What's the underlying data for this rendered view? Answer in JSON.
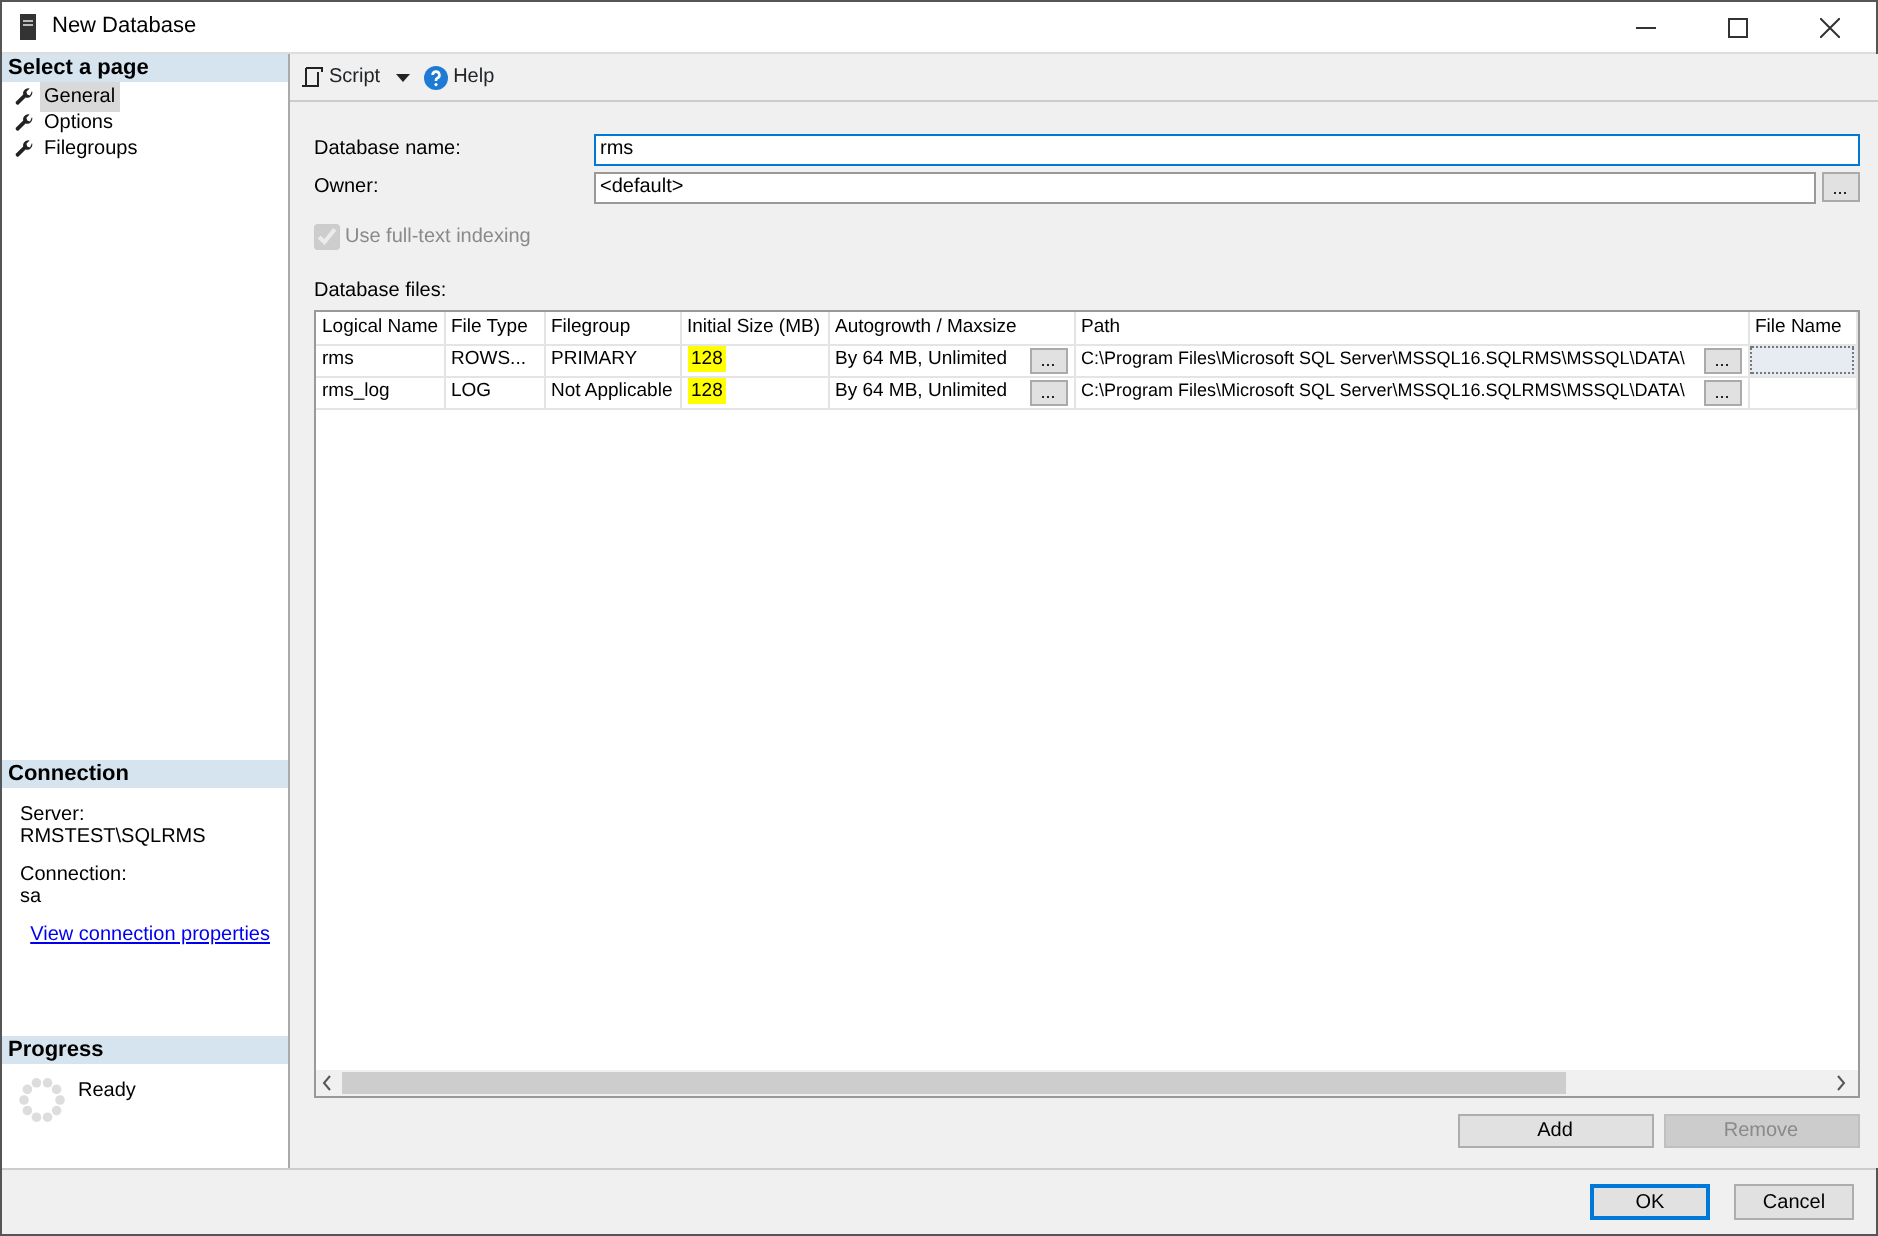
{
  "window": {
    "title": "New Database"
  },
  "sidebar": {
    "header": "Select a page",
    "items": [
      {
        "label": "General",
        "selected": true
      },
      {
        "label": "Options",
        "selected": false
      },
      {
        "label": "Filegroups",
        "selected": false
      }
    ]
  },
  "connection": {
    "header": "Connection",
    "server_label": "Server:",
    "server": "RMSTEST\\SQLRMS",
    "connection_label": "Connection:",
    "connection": "sa",
    "link": "View connection properties"
  },
  "progress": {
    "header": "Progress",
    "status": "Ready"
  },
  "toolbar": {
    "script": "Script",
    "help": "Help"
  },
  "form": {
    "database_name_label": "Database name:",
    "database_name": "rms",
    "owner_label": "Owner:",
    "owner": "<default>",
    "owner_browse": "...",
    "fulltext": {
      "label": "Use full-text indexing",
      "checked": true,
      "disabled": true
    }
  },
  "files": {
    "label": "Database files:",
    "columns": [
      "Logical Name",
      "File Type",
      "Filegroup",
      "Initial Size (MB)",
      "Autogrowth / Maxsize",
      "Path",
      "File Name"
    ],
    "rows": [
      {
        "logical_name": "rms",
        "file_type": "ROWS...",
        "filegroup": "PRIMARY",
        "initial_size": "128",
        "size_highlighted": true,
        "autogrowth": "By 64 MB, Unlimited",
        "autogrowth_button": "...",
        "path": "C:\\Program Files\\Microsoft SQL Server\\MSSQL16.SQLRMS\\MSSQL\\DATA\\",
        "path_button": "...",
        "file_name_focused": true
      },
      {
        "logical_name": "rms_log",
        "file_type": "LOG",
        "filegroup": "Not Applicable",
        "initial_size": "128",
        "size_highlighted": true,
        "autogrowth": "By 64 MB, Unlimited",
        "autogrowth_button": "...",
        "path": "C:\\Program Files\\Microsoft SQL Server\\MSSQL16.SQLRMS\\MSSQL\\DATA\\",
        "path_button": "...",
        "file_name_focused": false
      }
    ]
  },
  "file_buttons": [
    {
      "label": "Add",
      "disabled": false
    },
    {
      "label": "Remove",
      "disabled": true
    }
  ],
  "dialog_buttons": [
    {
      "label": "OK",
      "default": true
    },
    {
      "label": "Cancel",
      "default": false
    }
  ]
}
